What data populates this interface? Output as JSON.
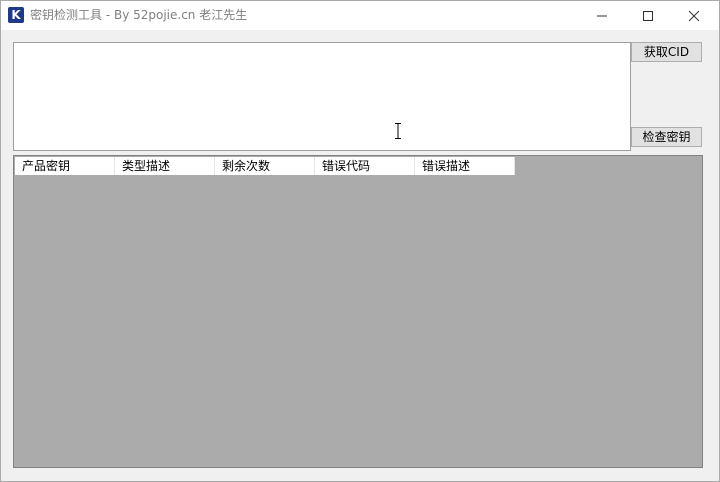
{
  "window": {
    "icon_letter": "K",
    "title": "密钥检测工具 - By 52pojie.cn 老江先生"
  },
  "key_input": {
    "value": ""
  },
  "buttons": {
    "get_cid": "获取CID",
    "check_key": "检查密钥"
  },
  "table": {
    "columns": [
      "产品密钥",
      "类型描述",
      "剩余次数",
      "错误代码",
      "错误描述"
    ],
    "rows": []
  }
}
